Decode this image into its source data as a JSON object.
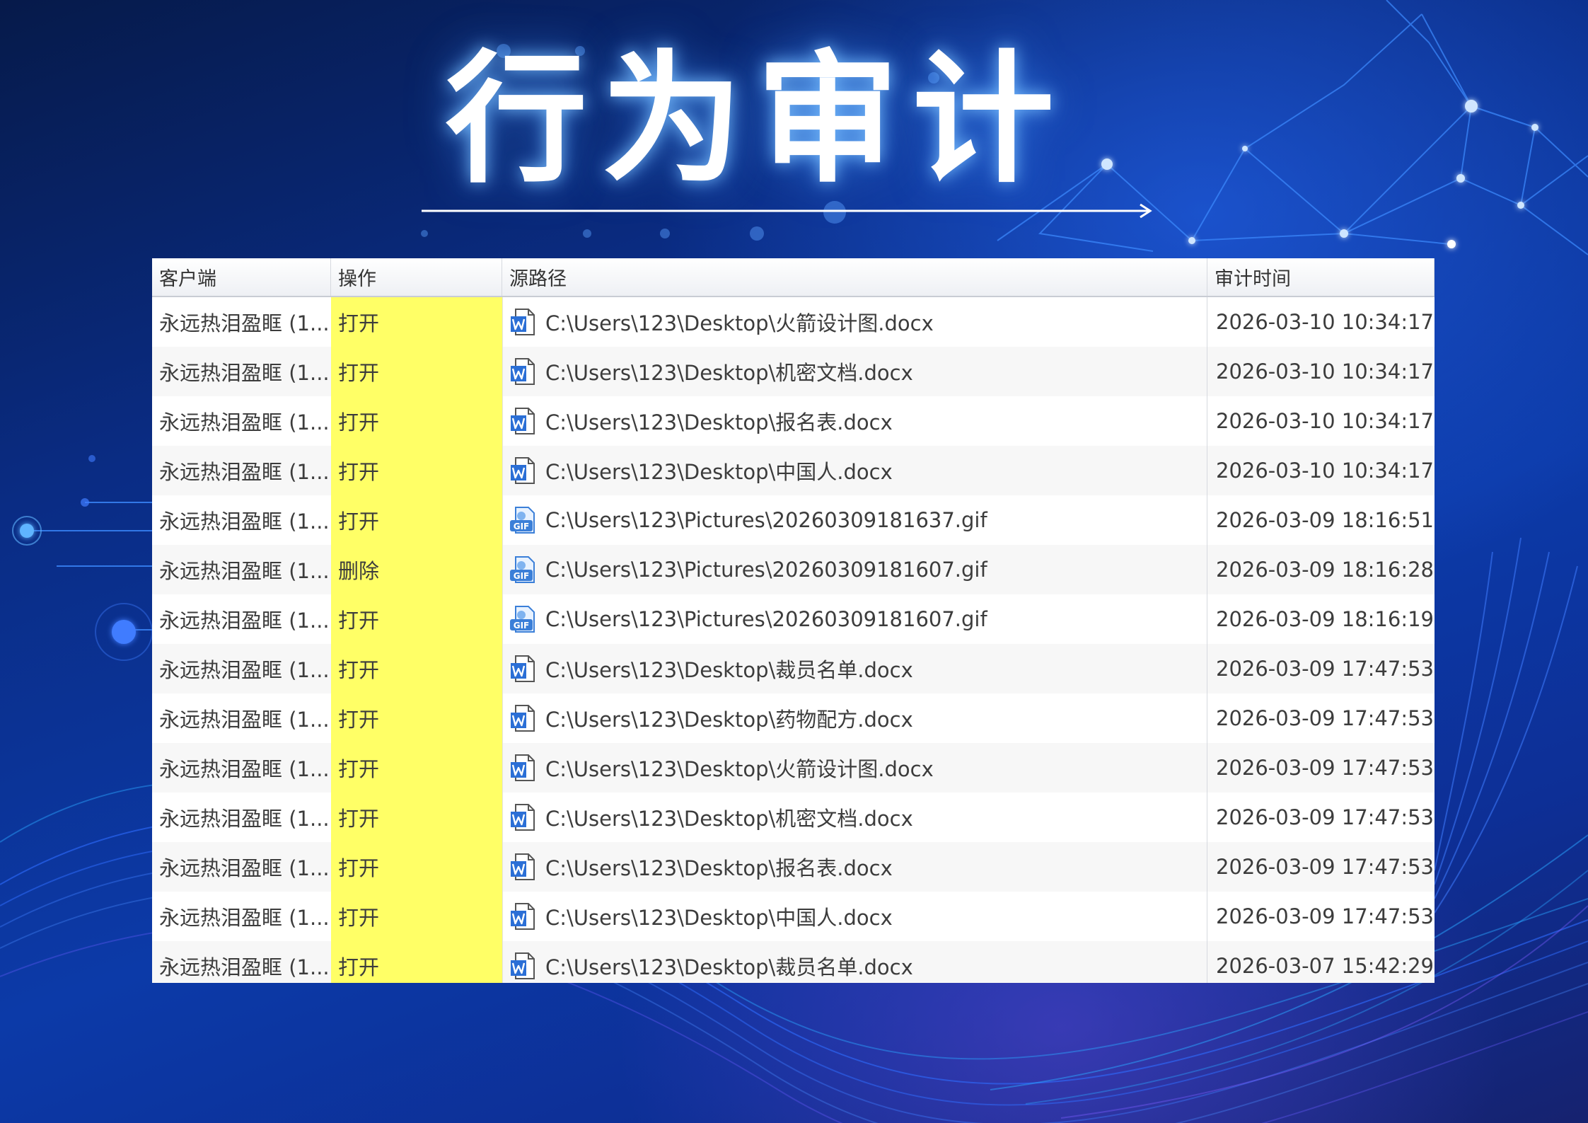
{
  "hero": {
    "title": "行为审计"
  },
  "table": {
    "columns": {
      "client": "客户端",
      "operation": "操作",
      "source_path": "源路径",
      "audit_time": "审计时间"
    },
    "rows": [
      {
        "client": "永远热泪盈眶 (1...",
        "operation": "打开",
        "icon": "word-doc-icon",
        "path": "C:\\Users\\123\\Desktop\\火箭设计图.docx",
        "time": "2026-03-10 10:34:17"
      },
      {
        "client": "永远热泪盈眶 (1...",
        "operation": "打开",
        "icon": "word-doc-icon",
        "path": "C:\\Users\\123\\Desktop\\机密文档.docx",
        "time": "2026-03-10 10:34:17"
      },
      {
        "client": "永远热泪盈眶 (1...",
        "operation": "打开",
        "icon": "word-doc-icon",
        "path": "C:\\Users\\123\\Desktop\\报名表.docx",
        "time": "2026-03-10 10:34:17"
      },
      {
        "client": "永远热泪盈眶 (1...",
        "operation": "打开",
        "icon": "word-doc-icon",
        "path": "C:\\Users\\123\\Desktop\\中国人.docx",
        "time": "2026-03-10 10:34:17"
      },
      {
        "client": "永远热泪盈眶 (1...",
        "operation": "打开",
        "icon": "gif-file-icon",
        "path": "C:\\Users\\123\\Pictures\\20260309181637.gif",
        "time": "2026-03-09 18:16:51"
      },
      {
        "client": "永远热泪盈眶 (1...",
        "operation": "删除",
        "icon": "gif-file-icon",
        "path": "C:\\Users\\123\\Pictures\\20260309181607.gif",
        "time": "2026-03-09 18:16:28"
      },
      {
        "client": "永远热泪盈眶 (1...",
        "operation": "打开",
        "icon": "gif-file-icon",
        "path": "C:\\Users\\123\\Pictures\\20260309181607.gif",
        "time": "2026-03-09 18:16:19"
      },
      {
        "client": "永远热泪盈眶 (1...",
        "operation": "打开",
        "icon": "word-doc-icon",
        "path": "C:\\Users\\123\\Desktop\\裁员名单.docx",
        "time": "2026-03-09 17:47:53"
      },
      {
        "client": "永远热泪盈眶 (1...",
        "operation": "打开",
        "icon": "word-doc-icon",
        "path": "C:\\Users\\123\\Desktop\\药物配方.docx",
        "time": "2026-03-09 17:47:53"
      },
      {
        "client": "永远热泪盈眶 (1...",
        "operation": "打开",
        "icon": "word-doc-icon",
        "path": "C:\\Users\\123\\Desktop\\火箭设计图.docx",
        "time": "2026-03-09 17:47:53"
      },
      {
        "client": "永远热泪盈眶 (1...",
        "operation": "打开",
        "icon": "word-doc-icon",
        "path": "C:\\Users\\123\\Desktop\\机密文档.docx",
        "time": "2026-03-09 17:47:53"
      },
      {
        "client": "永远热泪盈眶 (1...",
        "operation": "打开",
        "icon": "word-doc-icon",
        "path": "C:\\Users\\123\\Desktop\\报名表.docx",
        "time": "2026-03-09 17:47:53"
      },
      {
        "client": "永远热泪盈眶 (1...",
        "operation": "打开",
        "icon": "word-doc-icon",
        "path": "C:\\Users\\123\\Desktop\\中国人.docx",
        "time": "2026-03-09 17:47:53"
      },
      {
        "client": "永远热泪盈眶 (1...",
        "operation": "打开",
        "icon": "word-doc-icon",
        "path": "C:\\Users\\123\\Desktop\\裁员名单.docx",
        "time": "2026-03-07 15:42:29"
      }
    ]
  },
  "colors": {
    "background": "#0a2c84",
    "operation_highlight": "#ffff66",
    "title_glow": "#78beff",
    "word_blue": "#2b6fd6"
  }
}
